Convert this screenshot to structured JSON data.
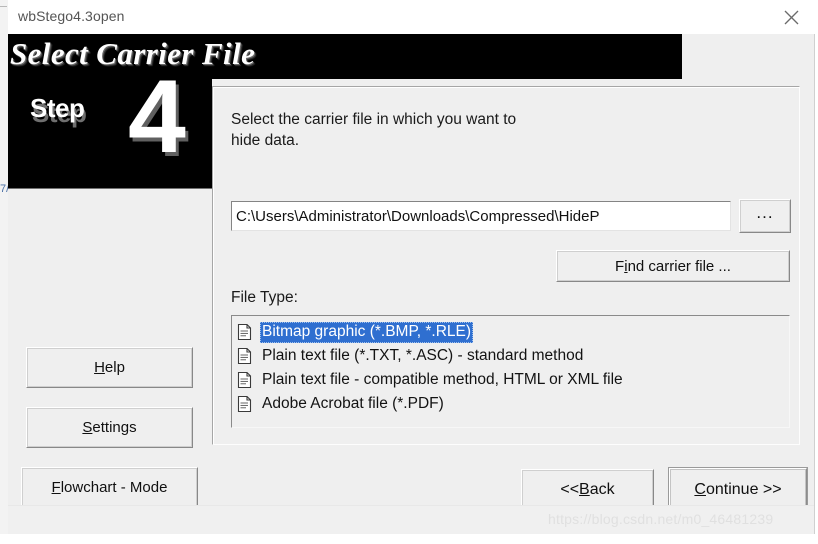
{
  "window": {
    "title": "wbStego4.3open",
    "close_icon": "close-icon"
  },
  "banner": {
    "title": "Select Carrier File"
  },
  "step_panel": {
    "word": "Step",
    "number": "4"
  },
  "content": {
    "instructions": "Select the carrier file in which you want to\nhide data.",
    "path_value": "C:\\Users\\Administrator\\Downloads\\Compressed\\HideP",
    "browse_button": "...",
    "find_button_prefix": "F",
    "find_button_accel": "i",
    "find_button_suffix": "nd carrier file ...",
    "filetype_label": "File Type:",
    "filetypes": [
      {
        "label": "Bitmap graphic (*.BMP, *.RLE)",
        "selected": true,
        "icon": "document-icon"
      },
      {
        "label": "Plain text file (*.TXT, *.ASC) - standard method",
        "selected": false,
        "icon": "document-icon"
      },
      {
        "label": "Plain text file - compatible method, HTML or XML file",
        "selected": false,
        "icon": "document-icon"
      },
      {
        "label": "Adobe Acrobat file (*.PDF)",
        "selected": false,
        "icon": "document-icon"
      }
    ]
  },
  "side_buttons": {
    "help": {
      "accel": "H",
      "rest": "elp"
    },
    "settings": {
      "accel": "S",
      "rest": "ettings"
    },
    "flowchart": {
      "accel": "F",
      "rest": "lowchart - Mode"
    }
  },
  "nav_buttons": {
    "back": {
      "prefix": "<< ",
      "accel": "B",
      "rest": "ack"
    },
    "continue": {
      "accel": "C",
      "rest": "ontinue >>"
    }
  },
  "watermark": "https://blog.csdn.net/m0_46481239",
  "colors": {
    "banner_bg": "#000000",
    "selection_blue": "#2f6fd0",
    "dialog_bg": "#efefef",
    "text": "#131313"
  }
}
